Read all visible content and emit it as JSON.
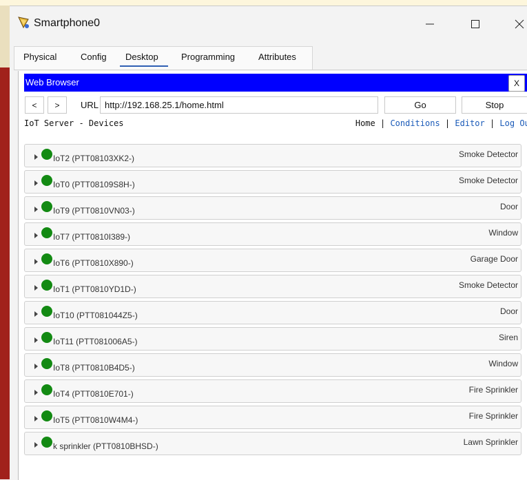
{
  "window": {
    "title": "Smartphone0"
  },
  "tabs": [
    "Physical",
    "Config",
    "Desktop",
    "Programming",
    "Attributes"
  ],
  "browser": {
    "header": "Web Browser",
    "close_label": "X",
    "back_label": "<",
    "forward_label": ">",
    "url_label": "URL",
    "url_value": "http://192.168.25.1/home.html",
    "go_label": "Go",
    "stop_label": "Stop"
  },
  "page": {
    "title": "IoT Server - Devices",
    "nav_home": "Home",
    "nav_sep": " | ",
    "nav_links": [
      "Conditions",
      "Editor",
      "Log Out"
    ]
  },
  "colors": {
    "status_on": "#138a13",
    "browser_header": "#0000ff",
    "link": "#1a5ab8"
  },
  "devices": [
    {
      "name": "IoT2 (PTT08103XK2-)",
      "type": "Smoke Detector",
      "status_icon": "green-dot-icon"
    },
    {
      "name": "IoT0 (PTT08109S8H-)",
      "type": "Smoke Detector",
      "status_icon": "green-dot-icon"
    },
    {
      "name": "IoT9 (PTT0810VN03-)",
      "type": "Door",
      "status_icon": "green-dot-icon"
    },
    {
      "name": "IoT7 (PTT0810I389-)",
      "type": "Window",
      "status_icon": "green-dot-icon"
    },
    {
      "name": "IoT6 (PTT0810X890-)",
      "type": "Garage Door",
      "status_icon": "green-dot-icon"
    },
    {
      "name": "IoT1 (PTT0810YD1D-)",
      "type": "Smoke Detector",
      "status_icon": "green-dot-icon"
    },
    {
      "name": "IoT10 (PTT081044Z5-)",
      "type": "Door",
      "status_icon": "green-dot-icon"
    },
    {
      "name": "IoT11 (PTT081006A5-)",
      "type": "Siren",
      "status_icon": "green-dot-icon"
    },
    {
      "name": "IoT8 (PTT0810B4D5-)",
      "type": "Window",
      "status_icon": "green-dot-icon"
    },
    {
      "name": "IoT4 (PTT0810E701-)",
      "type": "Fire Sprinkler",
      "status_icon": "green-dot-icon"
    },
    {
      "name": "IoT5 (PTT0810W4M4-)",
      "type": "Fire Sprinkler",
      "status_icon": "green-dot-icon"
    },
    {
      "name": "k sprinkler (PTT0810BHSD-)",
      "type": "Lawn Sprinkler",
      "status_icon": "green-dot-icon"
    }
  ]
}
